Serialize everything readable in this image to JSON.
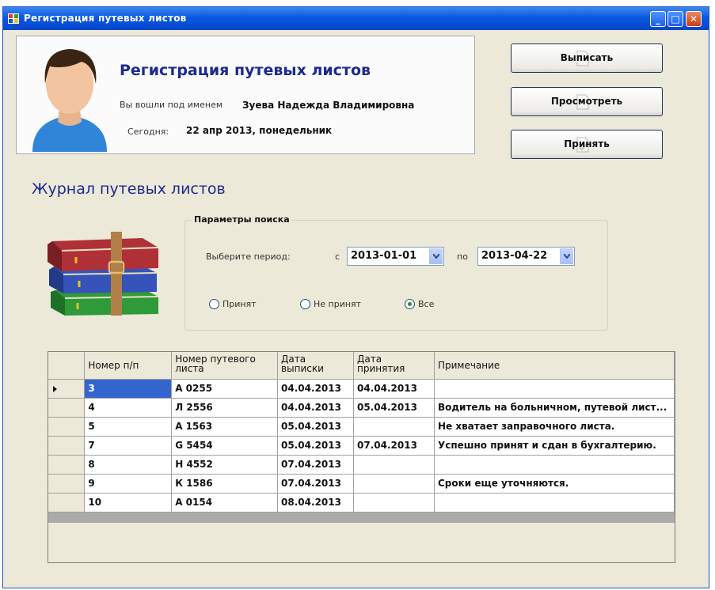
{
  "window": {
    "title": "Регистрация путевых листов",
    "buttons": {
      "minimize": "_",
      "maximize": "□",
      "close": "✕"
    }
  },
  "header": {
    "heading": "Регистрация путевых листов",
    "login_label": "Вы вошли под именем",
    "login_value": "Зуева Надежда Владимировна",
    "today_label": "Сегодня:",
    "today_value": "22 апр 2013, понедельник"
  },
  "actions": {
    "issue": "Выписать",
    "view": "Просмотреть",
    "accept": "Принять"
  },
  "journal": {
    "title": "Журнал путевых листов"
  },
  "search": {
    "legend": "Параметры поиска",
    "period_label": "Выберите период:",
    "from_label": "с",
    "from_value": "2013-01-01",
    "to_label": "по",
    "to_value": "2013-04-22",
    "radio": {
      "accepted": "Принят",
      "not_accepted": "Не принят",
      "all": "Все"
    },
    "selected_radio": "all"
  },
  "table": {
    "columns": [
      {
        "label": "Номер п/п"
      },
      {
        "label": "Номер путевого листа"
      },
      {
        "label": "Дата выписки"
      },
      {
        "label": "Дата принятия"
      },
      {
        "label": "Примечание"
      }
    ],
    "rows": [
      {
        "num": "3",
        "sheet": "А 0255",
        "issued": "04.04.2013",
        "accepted": "04.04.2013",
        "note": ""
      },
      {
        "num": "4",
        "sheet": "Л 2556",
        "issued": "04.04.2013",
        "accepted": "05.04.2013",
        "note": "Водитель на больничном, путевой лист..."
      },
      {
        "num": "5",
        "sheet": "А 1563",
        "issued": "05.04.2013",
        "accepted": "",
        "note": "Не хватает заправочного листа."
      },
      {
        "num": "7",
        "sheet": "G 5454",
        "issued": "05.04.2013",
        "accepted": "07.04.2013",
        "note": "Успешно принят и сдан в бухгалтерию."
      },
      {
        "num": "8",
        "sheet": "Н 4552",
        "issued": "07.04.2013",
        "accepted": "",
        "note": ""
      },
      {
        "num": "9",
        "sheet": "К 1586",
        "issued": "07.04.2013",
        "accepted": "",
        "note": "Сроки еще уточняются."
      },
      {
        "num": "10",
        "sheet": "А 0154",
        "issued": "08.04.2013",
        "accepted": "",
        "note": ""
      }
    ]
  }
}
